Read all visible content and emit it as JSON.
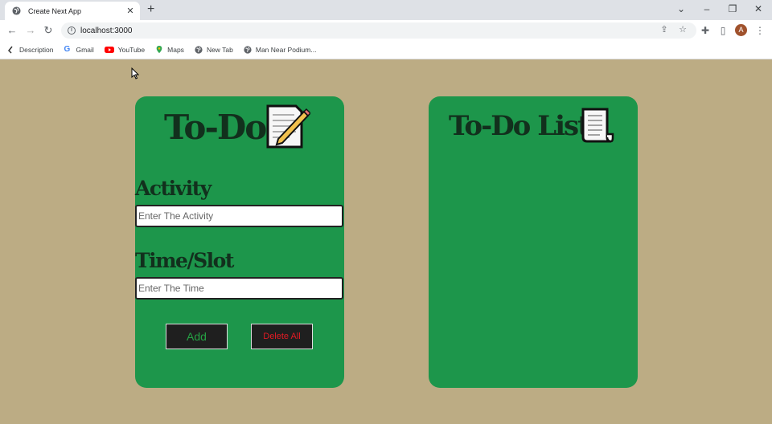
{
  "browser": {
    "tab_title": "Create Next App",
    "tab_close_glyph": "✕",
    "new_tab_glyph": "+",
    "url": "localhost:3000",
    "avatar_letter": "A",
    "bookmarks": [
      {
        "label": "Description",
        "icon": "description-favicon"
      },
      {
        "label": "Gmail",
        "icon": "google-g-icon"
      },
      {
        "label": "YouTube",
        "icon": "youtube-icon"
      },
      {
        "label": "Maps",
        "icon": "maps-pin-icon"
      },
      {
        "label": "New Tab",
        "icon": "globe-icon"
      },
      {
        "label": "Man Near Podium...",
        "icon": "globe-icon"
      }
    ]
  },
  "todo_form": {
    "title": "To-Do",
    "title_icon": "memo-pencil-icon",
    "activity_label": "Activity",
    "activity_placeholder": "Enter The Activity",
    "activity_value": "",
    "time_label": "Time/Slot",
    "time_placeholder": "Enter The Time",
    "time_value": "",
    "add_label": "Add",
    "delete_all_label": "Delete All"
  },
  "todo_list": {
    "title": "To-Do List",
    "title_icon": "page-scroll-icon",
    "items": []
  },
  "colors": {
    "page_bg": "#bcac84",
    "card_bg": "#1d964b",
    "title_text": "#12301d",
    "button_bg": "#1f1f1f",
    "add_text": "#25a244",
    "delete_text": "#e01b24"
  }
}
